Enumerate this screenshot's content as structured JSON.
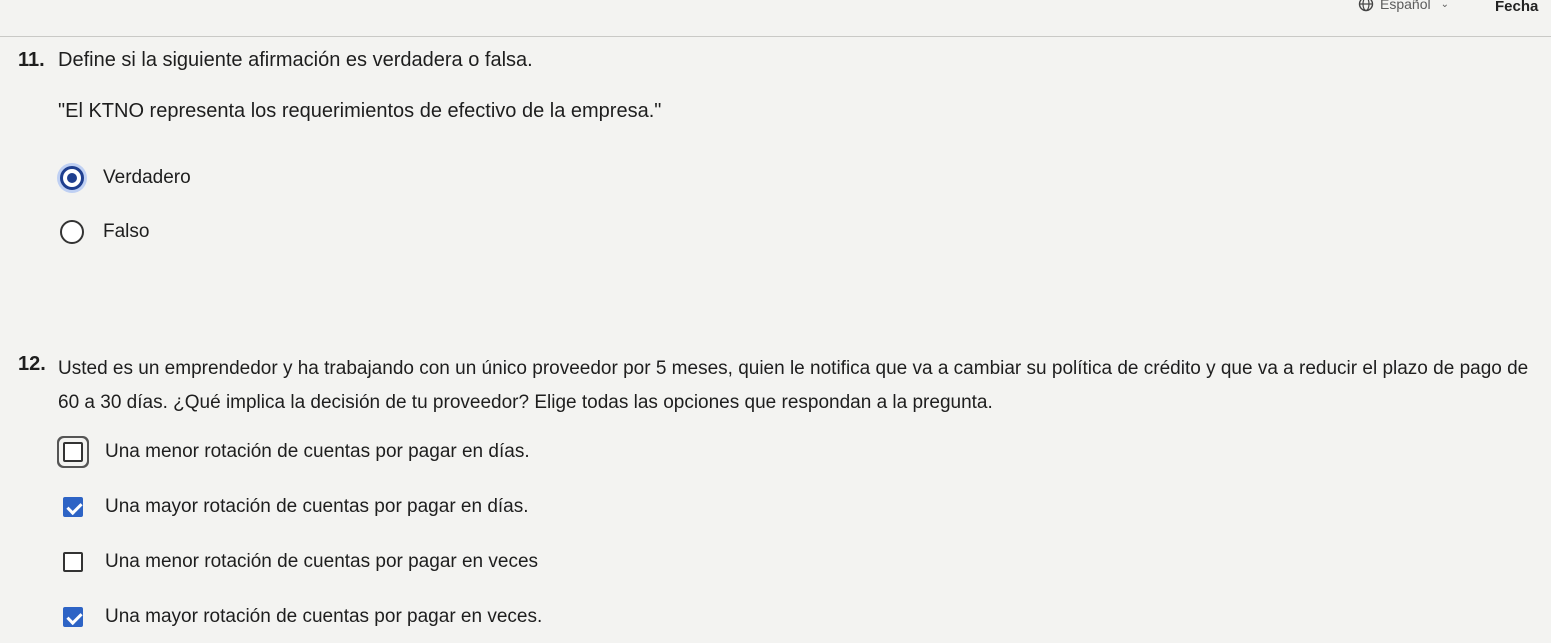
{
  "header": {
    "language": "Español",
    "language_icon": "globe-icon",
    "date_label": "Fecha"
  },
  "q11": {
    "number": "11.",
    "prompt": "Define si la siguiente afirmación es verdadera o falsa.",
    "statement": "\"El KTNO representa los requerimientos de efectivo de la empresa.\"",
    "options": [
      {
        "label": "Verdadero",
        "selected": true
      },
      {
        "label": "Falso",
        "selected": false
      }
    ]
  },
  "q12": {
    "number": "12.",
    "prompt": "Usted es un emprendedor y ha trabajando con un único proveedor por 5 meses, quien le notifica que va a cambiar su política de crédito y que va a reducir el plazo de pago de 60 a 30 días. ¿Qué implica la decisión de tu proveedor? Elige todas las opciones que respondan a la pregunta.",
    "options": [
      {
        "label": "Una menor rotación de cuentas por pagar en días.",
        "checked": false
      },
      {
        "label": "Una mayor rotación de cuentas por pagar en días.",
        "checked": true
      },
      {
        "label": "Una menor rotación de cuentas por pagar en veces",
        "checked": false
      },
      {
        "label": "Una mayor rotación de cuentas por pagar en veces.",
        "checked": true
      }
    ]
  },
  "colors": {
    "radio_selected": "#1f3f8f",
    "checkbox_checked": "#2d63c5"
  }
}
